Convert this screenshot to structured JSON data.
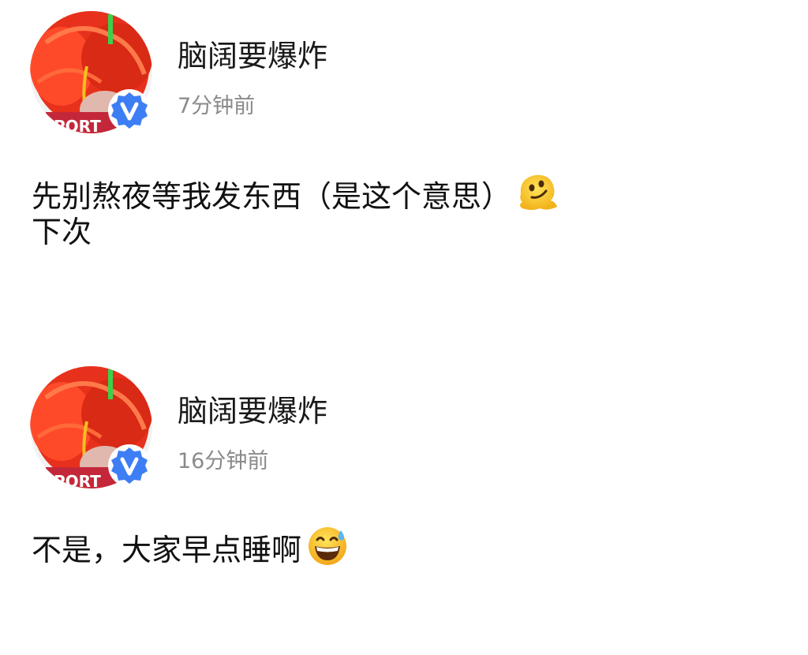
{
  "posts": [
    {
      "username": "脑阔要爆炸",
      "timestamp": "7分钟前",
      "lines": [
        "先别熬夜等我发东西（是这个意思）",
        "下次"
      ],
      "emoji": "melting-face-icon"
    },
    {
      "username": "脑阔要爆炸",
      "timestamp": "16分钟前",
      "lines": [
        "不是，大家早点睡啊"
      ],
      "emoji": "grinning-face-with-sweat-icon"
    }
  ],
  "colors": {
    "verified_badge": "#3d7ef5",
    "avatar_hair": "#e8311c",
    "timestamp": "#8a8a8a",
    "text": "#111111"
  }
}
